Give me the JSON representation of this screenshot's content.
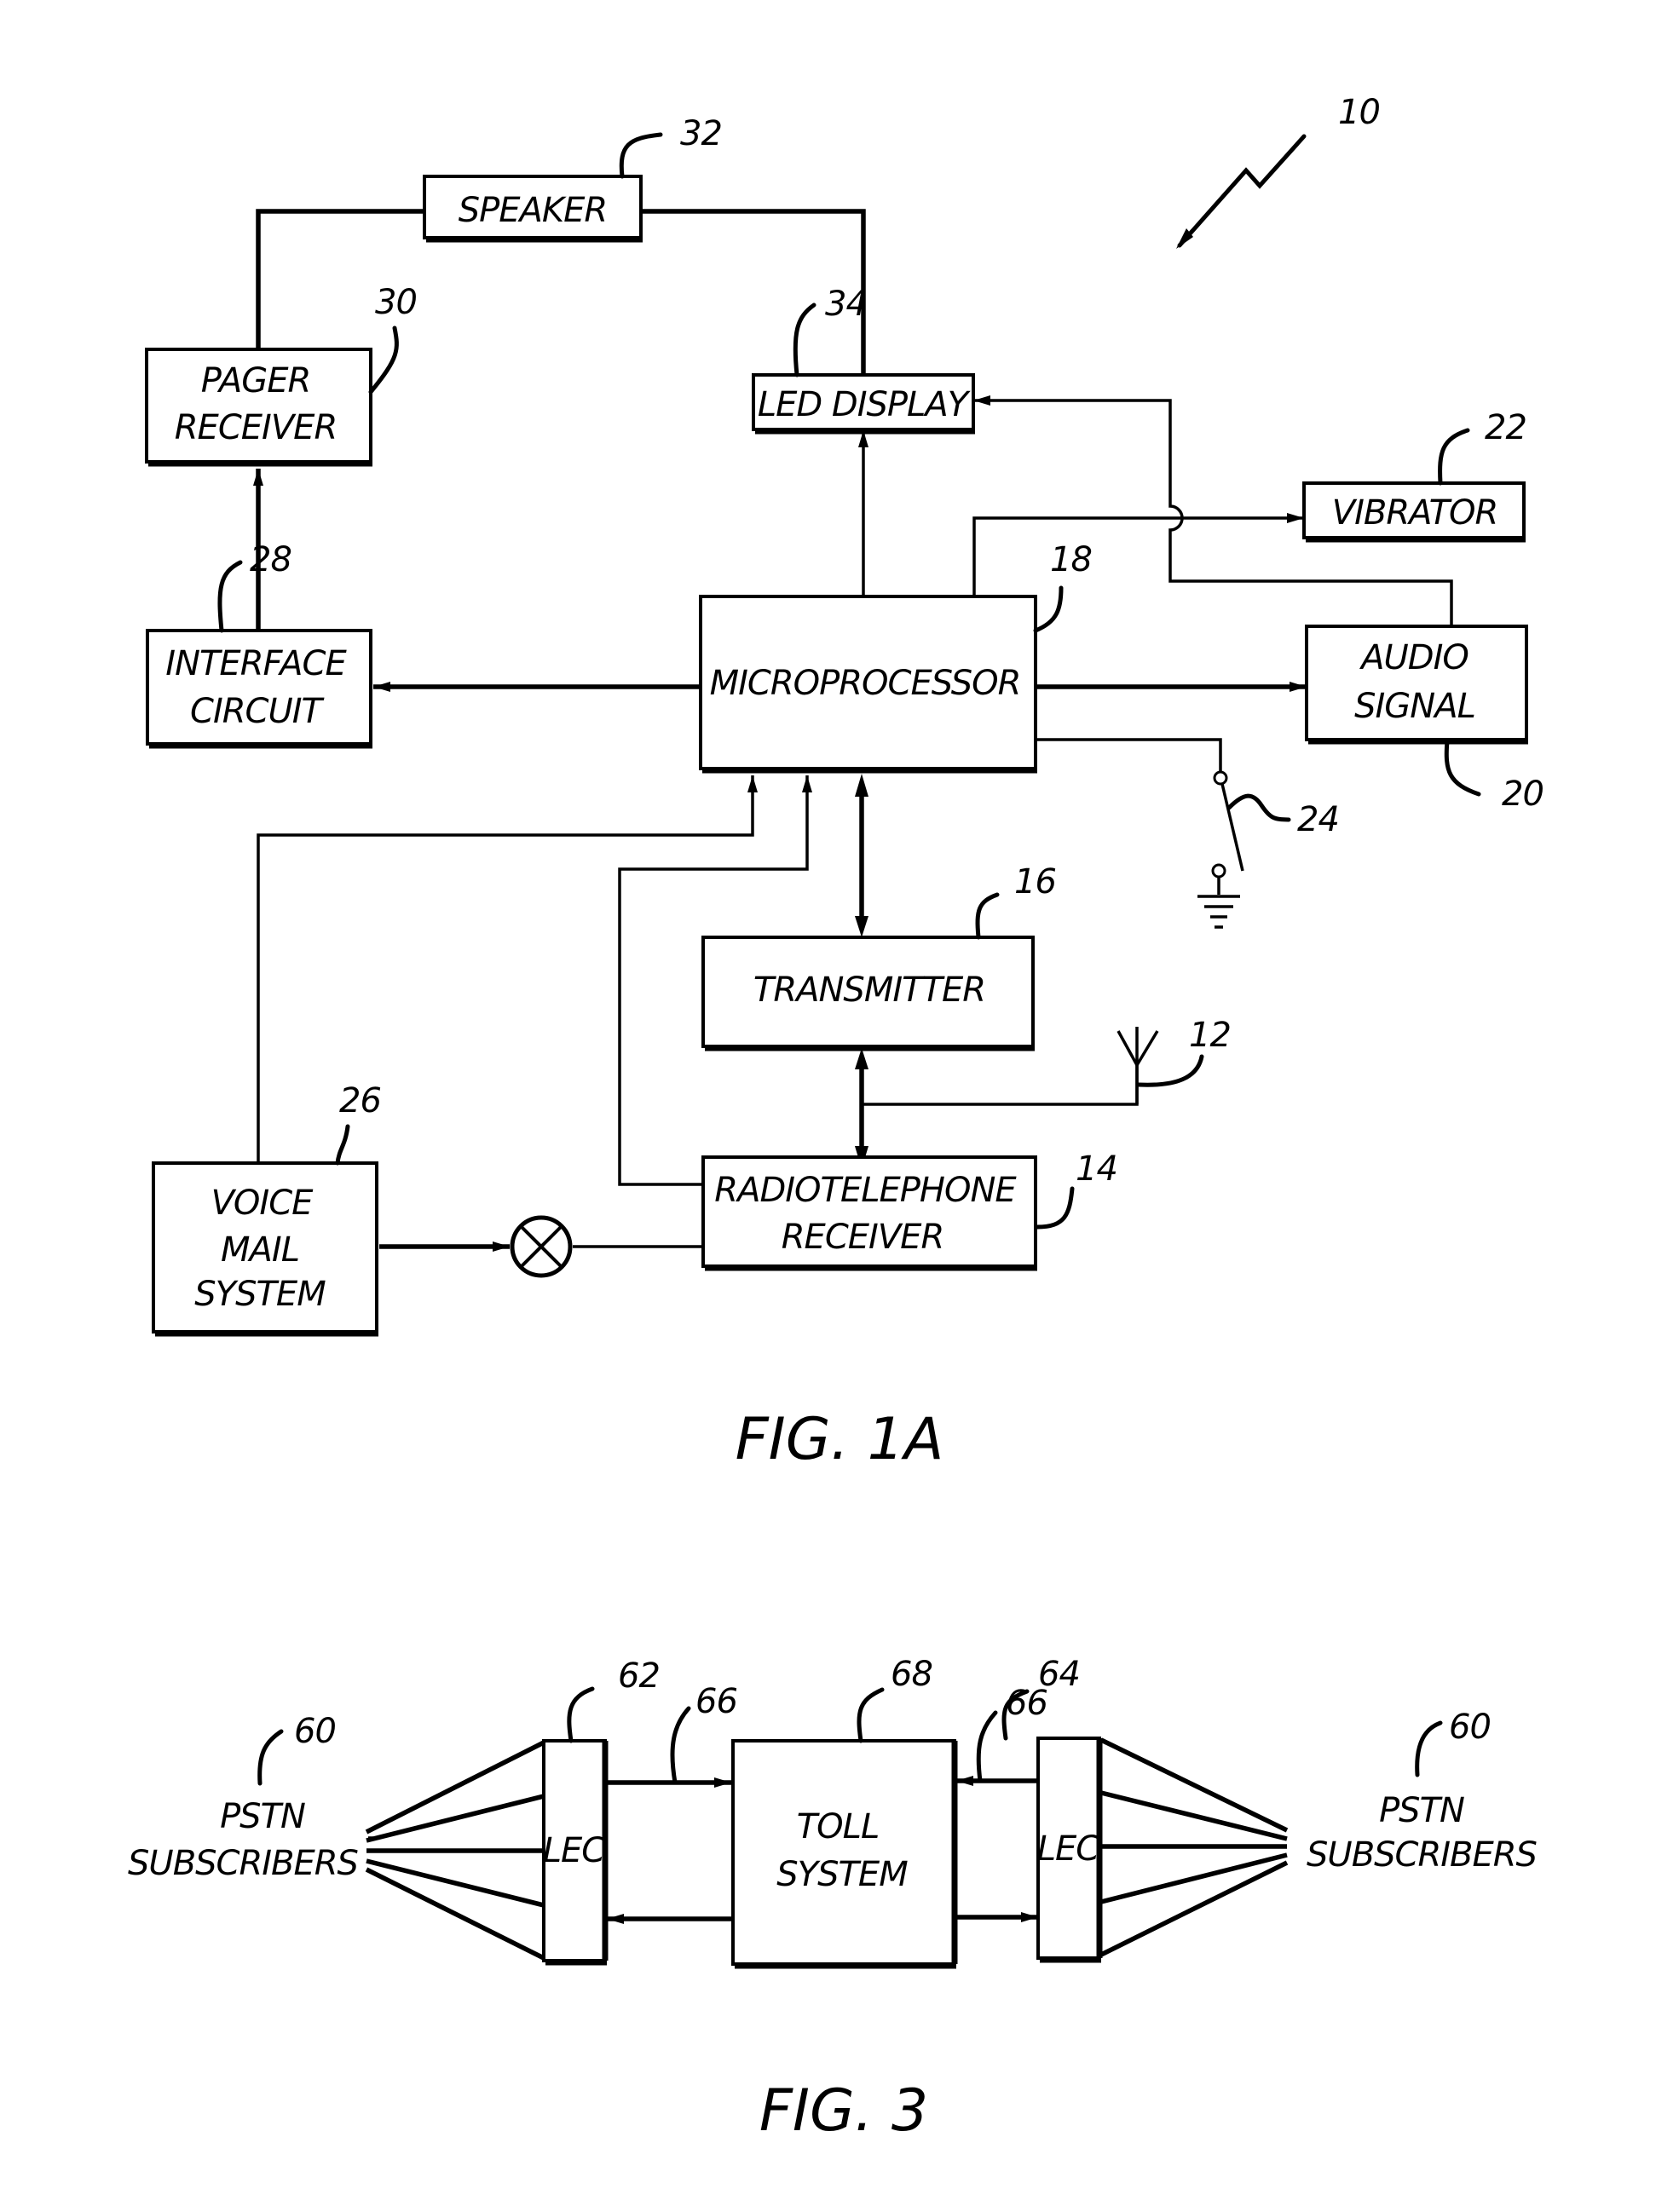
{
  "fig1a": {
    "caption": "FIG. 1A",
    "system_ref": "10",
    "blocks": {
      "speaker": {
        "label": [
          "SPEAKER"
        ],
        "ref": "32"
      },
      "pager_receiver": {
        "label": [
          "PAGER",
          "RECEIVER"
        ],
        "ref": "30"
      },
      "led_display": {
        "label": [
          "LED DISPLAY"
        ],
        "ref": "34"
      },
      "vibrator": {
        "label": [
          "VIBRATOR"
        ],
        "ref": "22"
      },
      "interface": {
        "label": [
          "INTERFACE",
          "CIRCUIT"
        ],
        "ref": "28"
      },
      "microprocessor": {
        "label": [
          "MICROPROCESSOR"
        ],
        "ref": "18"
      },
      "audio_signal": {
        "label": [
          "AUDIO",
          "SIGNAL"
        ],
        "ref": "20"
      },
      "switch": {
        "ref": "24"
      },
      "transmitter": {
        "label": [
          "TRANSMITTER"
        ],
        "ref": "16"
      },
      "antenna": {
        "ref": "12"
      },
      "voice_mail": {
        "label": [
          "VOICE",
          "MAIL",
          "SYSTEM"
        ],
        "ref": "26"
      },
      "radio_receiver": {
        "label": [
          "RADIOTELEPHONE",
          "RECEIVER"
        ],
        "ref": "14"
      }
    }
  },
  "fig3": {
    "caption": "FIG. 3",
    "left_subscribers": {
      "label": [
        "PSTN",
        "SUBSCRIBERS"
      ],
      "ref": "60"
    },
    "left_lec": {
      "label": [
        "LEC"
      ],
      "ref": "62"
    },
    "left_trunk_ref": "66",
    "toll_system": {
      "label": [
        "TOLL",
        "SYSTEM"
      ],
      "ref": "68"
    },
    "right_trunk_ref": "66",
    "right_lec": {
      "label": [
        "LEC"
      ],
      "ref": "64"
    },
    "right_subscribers": {
      "label": [
        "PSTN",
        "SUBSCRIBERS"
      ],
      "ref": "60"
    }
  }
}
